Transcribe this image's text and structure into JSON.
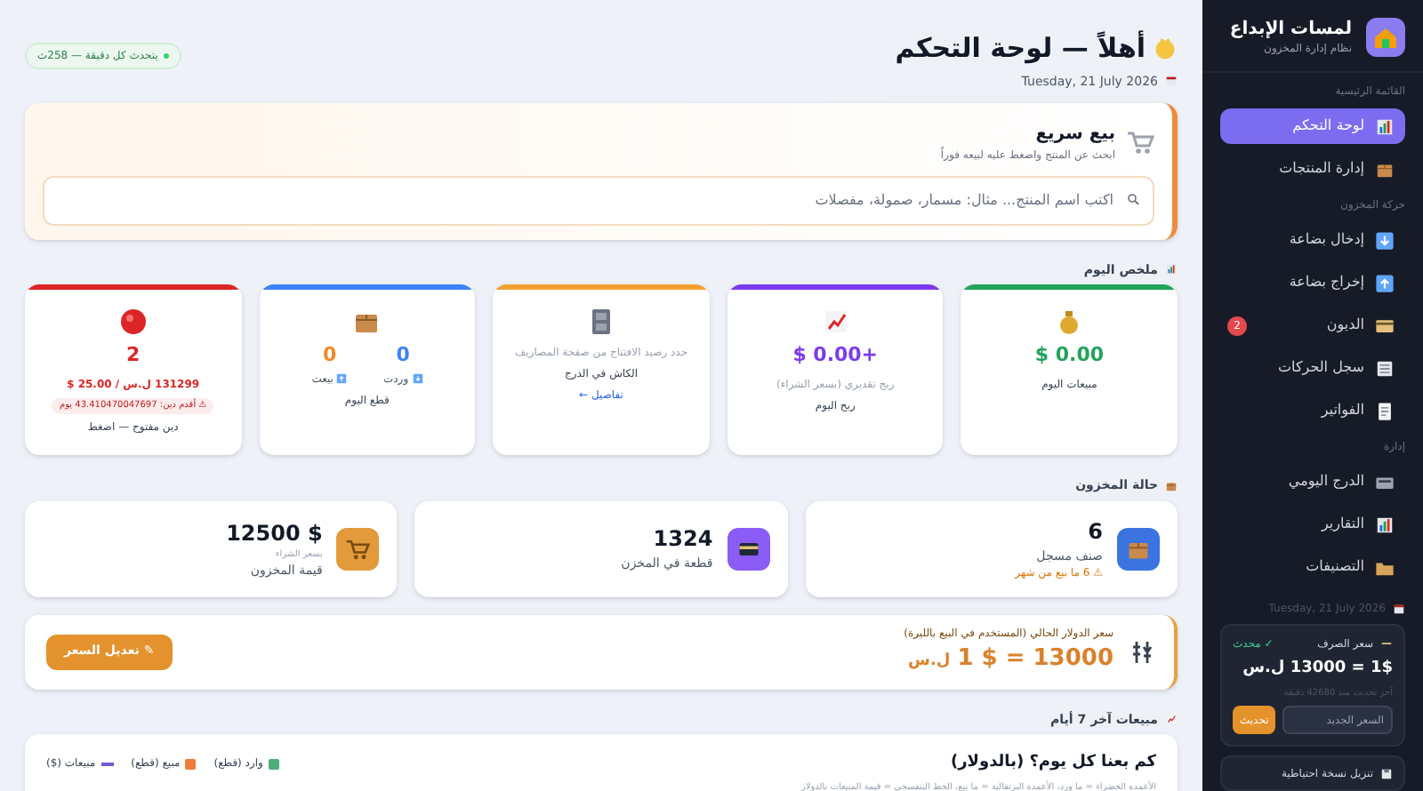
{
  "sidebar": {
    "brand": {
      "title": "لمسات الإبداع",
      "subtitle": "نظام إدارة المخزون"
    },
    "sections": [
      {
        "label": "القائمة الرئيسية",
        "items": [
          {
            "label": "لوحة التحكم",
            "selected": true
          },
          {
            "label": "إدارة المنتجات",
            "selected": false
          }
        ]
      },
      {
        "label": "حركة المخزون",
        "items": [
          {
            "label": "إدخال بضاعة",
            "selected": false
          },
          {
            "label": "إخراج بضاعة",
            "selected": false
          },
          {
            "label": "الديون",
            "selected": false,
            "badge": "2"
          },
          {
            "label": "سجل الحركات",
            "selected": false
          },
          {
            "label": "الفواتير",
            "selected": false
          }
        ]
      },
      {
        "label": "إدارة",
        "items": [
          {
            "label": "الدرج اليومي",
            "selected": false
          },
          {
            "label": "التقارير",
            "selected": false
          },
          {
            "label": "التصنيفات",
            "selected": false
          }
        ]
      }
    ],
    "date": "Tuesday, 21 July 2026",
    "rate_card": {
      "title": "سعر الصرف",
      "status": "✓ محدث",
      "rate": "1$ = 13000 ل.س",
      "updated": "آخر تحديث منذ 42680 دقيقة",
      "placeholder": "السعر الجديد",
      "button": "تحديث"
    },
    "backup_button": "تنزيل نسخة احتياطية"
  },
  "header": {
    "title": "أهلاً — لوحة التحكم",
    "date": "Tuesday, 21 July 2026",
    "refresh_badge": "يتحدث كل دقيقة — 258ث"
  },
  "quick_sale": {
    "title": "بيع سريع",
    "subtitle": "ابحث عن المنتج واضغط عليه لبيعه فوراً",
    "placeholder": "اكتب اسم المنتج... مثال: مسمار، صمولة، مفصلات"
  },
  "today": {
    "label": "ملخص اليوم",
    "cards": [
      {
        "kind": "value",
        "color": "#22a35a",
        "value": "$ 0.00",
        "caption": "مبيعات اليوم"
      },
      {
        "kind": "value",
        "color": "#7c3aed",
        "value": "$ 0.00+",
        "note": "ربح تقديري (بسعر الشراء)",
        "caption": "ربح اليوم"
      },
      {
        "kind": "cash",
        "color": "#f0a030",
        "note": "حدد رصيد الافتتاح من صفحة المصاريف",
        "caption": "الكاش في الدرج",
        "link": "تفاصيل ←"
      },
      {
        "kind": "pieces",
        "color": "#3b82f6",
        "in_value": "0",
        "in_label": "وردت",
        "out_value": "0",
        "out_label": "بيعت",
        "caption": "قطع اليوم"
      },
      {
        "kind": "debt",
        "color": "#dc2626",
        "value": "2",
        "amounts": "131299 ل.س / 25.00 $",
        "warning": "⚠ أقدم دين: 43.410470047697 يوم",
        "caption": "دين مفتوح — اضغط"
      }
    ]
  },
  "stock": {
    "label": "حالة المخزون",
    "cards": [
      {
        "value": "6",
        "caption": "صنف مسجل",
        "warning": "⚠ 6 ما بيع من شهر"
      },
      {
        "value": "1324",
        "caption": "قطعة في المخزن"
      },
      {
        "value": "$ 12500",
        "note": "بسعر الشراء",
        "caption": "قيمة المخزون"
      }
    ]
  },
  "dollar_banner": {
    "label": "سعر الدولار الحالي (المستخدم في البيع بالليرة)",
    "rate": "1 $ = 13000",
    "unit": "ل.س",
    "button": "✎ تعديل السعر"
  },
  "sales_chart": {
    "label": "مبيعات آخر 7 أيام",
    "title": "كم بعنا كل يوم؟ (بالدولار)",
    "subtitle": "الأعمدة الخضراء = ما ورد، الأعمدة البرتقالية = ما بيع، الخط البنفسجي = قيمة المبيعات بالدولار",
    "legend": [
      {
        "label": "وارد (قطع)",
        "color": "#4caf7a",
        "kind": "bar"
      },
      {
        "label": "مبيع (قطع)",
        "color": "#ee7b3a",
        "kind": "bar"
      },
      {
        "label": "مبيعات ($)",
        "color": "#6d5bd0",
        "kind": "line"
      }
    ]
  }
}
